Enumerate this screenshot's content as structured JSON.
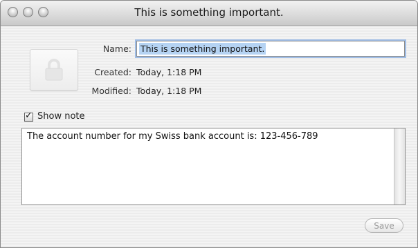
{
  "window": {
    "title": "This is something important.",
    "controls": [
      "close",
      "minimize",
      "zoom"
    ]
  },
  "icon": "lock-icon",
  "fields": {
    "name_label": "Name:",
    "name_value": "This is something important.",
    "created_label": "Created:",
    "created_value": "Today, 1:18 PM",
    "modified_label": "Modified:",
    "modified_value": "Today, 1:18 PM"
  },
  "show_note": {
    "label": "Show note",
    "checked": true
  },
  "note": {
    "text": "The account number for my Swiss bank account is: 123-456-789"
  },
  "buttons": {
    "save_label": "Save",
    "save_enabled": false
  }
}
